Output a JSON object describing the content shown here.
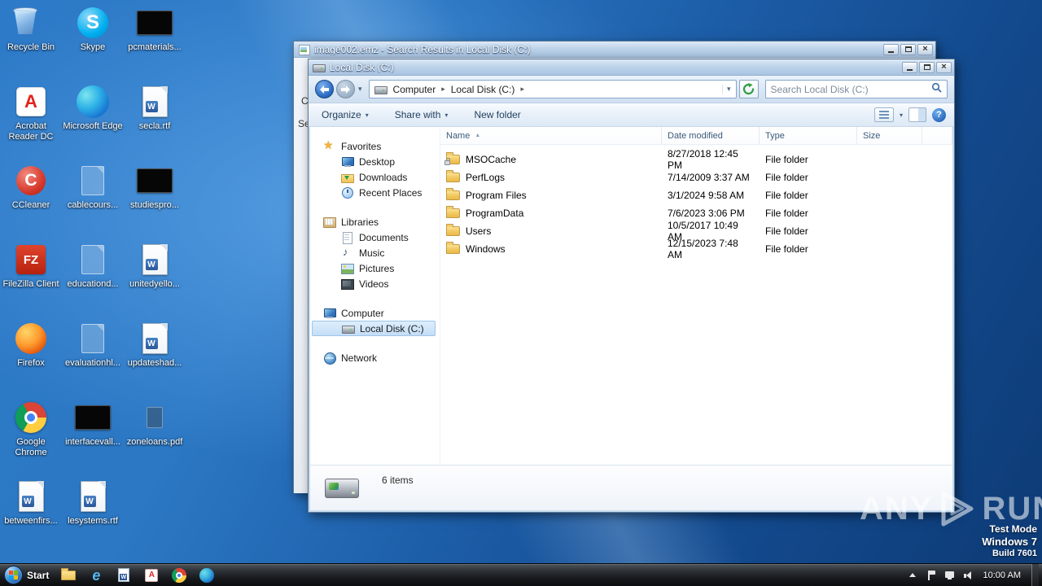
{
  "desktop": {
    "icons": [
      {
        "label": "Recycle Bin"
      },
      {
        "label": "Skype"
      },
      {
        "label": "pcmaterials..."
      },
      {
        "label": "Acrobat Reader DC"
      },
      {
        "label": "Microsoft Edge"
      },
      {
        "label": "secla.rtf"
      },
      {
        "label": "CCleaner"
      },
      {
        "label": "cablecours..."
      },
      {
        "label": "studiespro..."
      },
      {
        "label": "FileZilla Client"
      },
      {
        "label": "educationd..."
      },
      {
        "label": "unitedyello..."
      },
      {
        "label": "Firefox"
      },
      {
        "label": "evaluationhl..."
      },
      {
        "label": "updateshad..."
      },
      {
        "label": "Google Chrome"
      },
      {
        "label": "interfacevall..."
      },
      {
        "label": "zoneloans.pdf"
      },
      {
        "label": "betweenfirs..."
      },
      {
        "label": "lesystems.rtf"
      }
    ]
  },
  "back_window": {
    "title": "image002.emz - Search Results in Local Disk (C:)",
    "fragment_1": "C",
    "fragment_2": "Se"
  },
  "explorer": {
    "title": "Local Disk (C:)",
    "breadcrumb": {
      "root": "Computer",
      "current": "Local Disk (C:)"
    },
    "search": {
      "placeholder": "Search Local Disk (C:)"
    },
    "toolbar": {
      "organize": "Organize",
      "share_with": "Share with",
      "new_folder": "New folder"
    },
    "sidebar": {
      "favorites_label": "Favorites",
      "favorites": [
        "Desktop",
        "Downloads",
        "Recent Places"
      ],
      "libraries_label": "Libraries",
      "libraries": [
        "Documents",
        "Music",
        "Pictures",
        "Videos"
      ],
      "computer_label": "Computer",
      "computer_items": [
        "Local Disk (C:)"
      ],
      "network_label": "Network"
    },
    "columns": [
      "Name",
      "Date modified",
      "Type",
      "Size"
    ],
    "rows": [
      {
        "name": "MSOCache",
        "date_modified": "8/27/2018 12:45 PM",
        "type": "File folder",
        "size": ""
      },
      {
        "name": "PerfLogs",
        "date_modified": "7/14/2009 3:37 AM",
        "type": "File folder",
        "size": ""
      },
      {
        "name": "Program Files",
        "date_modified": "3/1/2024 9:58 AM",
        "type": "File folder",
        "size": ""
      },
      {
        "name": "ProgramData",
        "date_modified": "7/6/2023 3:06 PM",
        "type": "File folder",
        "size": ""
      },
      {
        "name": "Users",
        "date_modified": "10/5/2017 10:49 AM",
        "type": "File folder",
        "size": ""
      },
      {
        "name": "Windows",
        "date_modified": "12/15/2023 7:48 AM",
        "type": "File folder",
        "size": ""
      }
    ],
    "status": {
      "items_count": "6 items"
    }
  },
  "taskbar": {
    "start_label": "Start",
    "clock": "10:00 AM"
  },
  "watermark": {
    "brand_left": "ANY",
    "brand_right": "RUN",
    "line1": "Test Mode",
    "line2": "Windows 7",
    "line3": "Build 7601"
  }
}
